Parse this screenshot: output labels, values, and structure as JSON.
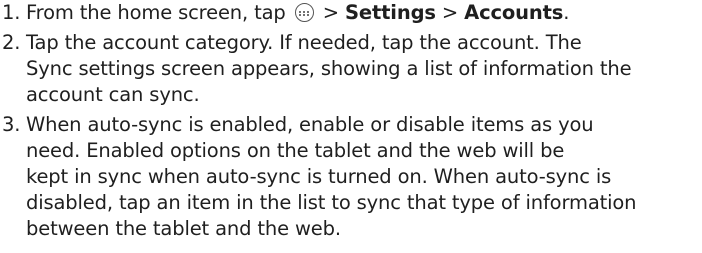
{
  "steps": [
    {
      "number": "1.",
      "parts": {
        "a": "From the home screen, tap ",
        "b": " > ",
        "c": "Settings",
        "d": " > ",
        "e": "Accounts",
        "f": "."
      },
      "icon": "apps-icon"
    },
    {
      "number": "2.",
      "lines": [
        "Tap the account category. If needed, tap the account. The",
        "Sync settings screen appears, showing a list of information the",
        "account can sync."
      ]
    },
    {
      "number": "3.",
      "lines": [
        "When auto-sync is enabled, enable or disable items as you",
        "need. Enabled options on the tablet and the web will be",
        "kept in sync when auto-sync is turned on. When auto-sync is",
        "disabled, tap an item in the list to sync that type of information",
        "between the tablet and the web."
      ]
    }
  ]
}
